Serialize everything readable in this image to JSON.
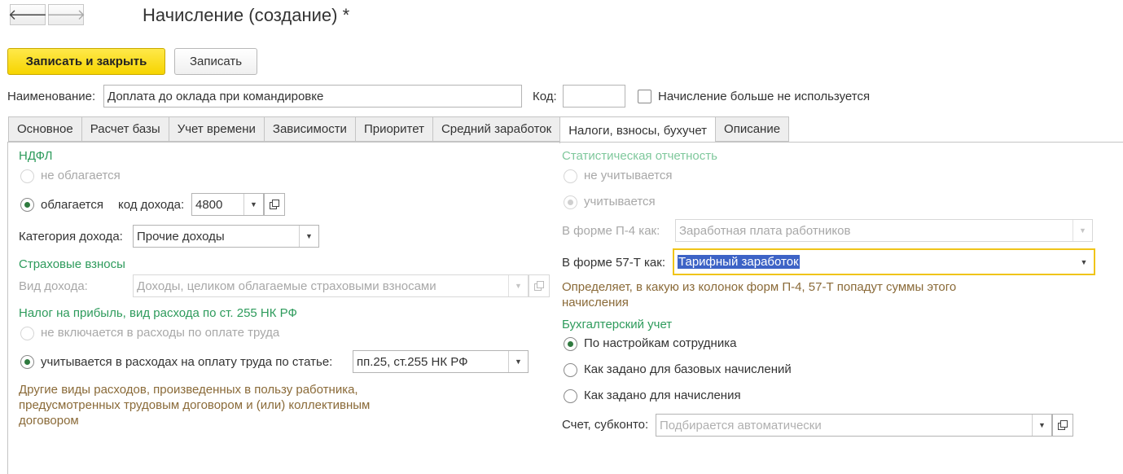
{
  "window": {
    "title": "Начисление (создание) *"
  },
  "nav": {
    "back_icon": "arrow-left-icon",
    "forward_icon": "arrow-right-icon"
  },
  "toolbar": {
    "save_close_label": "Записать и закрыть",
    "save_label": "Записать"
  },
  "header": {
    "name_label": "Наименование:",
    "name_value": "Доплата до оклада при командировке",
    "code_label": "Код:",
    "code_value": "",
    "not_used_label": "Начисление больше не используется",
    "not_used_checked": false
  },
  "tabs": [
    {
      "label": "Основное",
      "active": false
    },
    {
      "label": "Расчет базы",
      "active": false
    },
    {
      "label": "Учет времени",
      "active": false
    },
    {
      "label": "Зависимости",
      "active": false
    },
    {
      "label": "Приоритет",
      "active": false
    },
    {
      "label": "Средний заработок",
      "active": false
    },
    {
      "label": "Налоги, взносы, бухучет",
      "active": true
    },
    {
      "label": "Описание",
      "active": false
    }
  ],
  "ndfl": {
    "title": "НДФЛ",
    "option_not_taxed": "не облагается",
    "option_taxed": "облагается",
    "income_code_label": "код дохода:",
    "income_code_value": "4800",
    "income_category_label": "Категория дохода:",
    "income_category_value": "Прочие доходы"
  },
  "insurance": {
    "title": "Страховые взносы",
    "income_type_label": "Вид дохода:",
    "income_type_value": "Доходы, целиком облагаемые страховыми взносами"
  },
  "profit_tax": {
    "title": "Налог на прибыль, вид расхода по ст. 255 НК РФ",
    "option_excluded": "не включается в расходы по оплате труда",
    "option_included": "учитывается в расходах на оплату труда по статье:",
    "article_value": "пп.25, ст.255 НК РФ",
    "note": "Другие виды расходов, произведенных в пользу работника, предусмотренных трудовым договором и (или) коллективным договором"
  },
  "statistics": {
    "title": "Статистическая отчетность",
    "option_not_counted": "не учитывается",
    "option_counted": "учитывается",
    "p4_label": "В форме П-4 как:",
    "p4_value": "Заработная плата работников",
    "f57t_label": "В форме 57-Т как:",
    "f57t_value": "Тарифный заработок",
    "note": "Определяет, в какую из колонок форм П-4, 57-Т попадут суммы этого начисления"
  },
  "accounting": {
    "title": "Бухгалтерский учет",
    "option_employee": "По настройкам сотрудника",
    "option_base": "Как задано для базовых начислений",
    "option_accrual": "Как задано для начисления",
    "account_label": "Счет, субконто:",
    "account_placeholder": "Подбирается автоматически"
  },
  "colors": {
    "accent_yellow": "#f6d400",
    "section_green": "#2e9b5c",
    "note_brown": "#8a6a38",
    "selection_blue": "#3d63c6",
    "focus_border": "#f0c419"
  }
}
